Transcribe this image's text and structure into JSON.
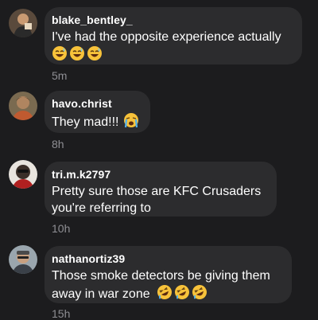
{
  "comments": [
    {
      "username": "blake_bentley_",
      "lines": [
        "I've had the opposite experience actually"
      ],
      "emojis": [
        "sweat-smile-emoji",
        "sweat-smile-emoji",
        "sweat-smile-emoji"
      ],
      "time": "5m"
    },
    {
      "username": "havo.christ",
      "lines": [
        "They mad!!!"
      ],
      "emojis": [
        "loudly-crying-emoji"
      ],
      "time": "8h"
    },
    {
      "username": "tri.m.k2797",
      "lines": [
        "Pretty sure those are KFC Crusaders",
        "you're referring to"
      ],
      "emojis": [],
      "time": "10h"
    },
    {
      "username": "nathanortiz39",
      "lines": [
        "Those smoke detectors be giving them",
        "away in war zone"
      ],
      "emojis": [
        "rofl-emoji",
        "rofl-emoji",
        "rofl-emoji"
      ],
      "time": "15h"
    }
  ],
  "colors": {
    "background": "#1c1c1e",
    "bubble": "#2c2c2e",
    "text": "#ffffff",
    "timestamp": "#8e8e93"
  }
}
